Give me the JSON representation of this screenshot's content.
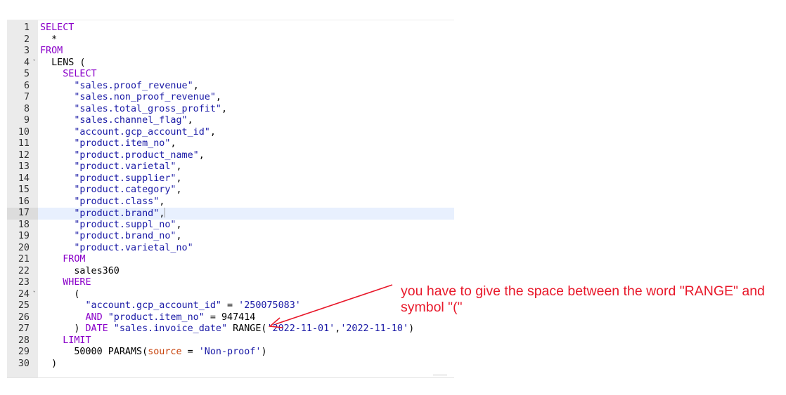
{
  "editor": {
    "active_line": 17,
    "fold_lines": [
      4,
      24
    ],
    "lines": [
      {
        "n": "1",
        "tokens": [
          {
            "t": "SELECT",
            "c": "kw"
          }
        ]
      },
      {
        "n": "2",
        "tokens": [
          {
            "t": "  *",
            "c": ""
          }
        ]
      },
      {
        "n": "3",
        "tokens": [
          {
            "t": "FROM",
            "c": "kw"
          }
        ]
      },
      {
        "n": "4",
        "tokens": [
          {
            "t": "  LENS (",
            "c": ""
          }
        ]
      },
      {
        "n": "5",
        "tokens": [
          {
            "t": "    ",
            "c": ""
          },
          {
            "t": "SELECT",
            "c": "kw"
          }
        ]
      },
      {
        "n": "6",
        "tokens": [
          {
            "t": "      ",
            "c": ""
          },
          {
            "t": "\"sales.proof_revenue\"",
            "c": "str"
          },
          {
            "t": ",",
            "c": ""
          }
        ]
      },
      {
        "n": "7",
        "tokens": [
          {
            "t": "      ",
            "c": ""
          },
          {
            "t": "\"sales.non_proof_revenue\"",
            "c": "str"
          },
          {
            "t": ",",
            "c": ""
          }
        ]
      },
      {
        "n": "8",
        "tokens": [
          {
            "t": "      ",
            "c": ""
          },
          {
            "t": "\"sales.total_gross_profit\"",
            "c": "str"
          },
          {
            "t": ",",
            "c": ""
          }
        ]
      },
      {
        "n": "9",
        "tokens": [
          {
            "t": "      ",
            "c": ""
          },
          {
            "t": "\"sales.channel_flag\"",
            "c": "str"
          },
          {
            "t": ",",
            "c": ""
          }
        ]
      },
      {
        "n": "10",
        "tokens": [
          {
            "t": "      ",
            "c": ""
          },
          {
            "t": "\"account.gcp_account_id\"",
            "c": "str"
          },
          {
            "t": ",",
            "c": ""
          }
        ]
      },
      {
        "n": "11",
        "tokens": [
          {
            "t": "      ",
            "c": ""
          },
          {
            "t": "\"product.item_no\"",
            "c": "str"
          },
          {
            "t": ",",
            "c": ""
          }
        ]
      },
      {
        "n": "12",
        "tokens": [
          {
            "t": "      ",
            "c": ""
          },
          {
            "t": "\"product.product_name\"",
            "c": "str"
          },
          {
            "t": ",",
            "c": ""
          }
        ]
      },
      {
        "n": "13",
        "tokens": [
          {
            "t": "      ",
            "c": ""
          },
          {
            "t": "\"product.varietal\"",
            "c": "str"
          },
          {
            "t": ",",
            "c": ""
          }
        ]
      },
      {
        "n": "14",
        "tokens": [
          {
            "t": "      ",
            "c": ""
          },
          {
            "t": "\"product.supplier\"",
            "c": "str"
          },
          {
            "t": ",",
            "c": ""
          }
        ]
      },
      {
        "n": "15",
        "tokens": [
          {
            "t": "      ",
            "c": ""
          },
          {
            "t": "\"product.category\"",
            "c": "str"
          },
          {
            "t": ",",
            "c": ""
          }
        ]
      },
      {
        "n": "16",
        "tokens": [
          {
            "t": "      ",
            "c": ""
          },
          {
            "t": "\"product.class\"",
            "c": "str"
          },
          {
            "t": ",",
            "c": ""
          }
        ]
      },
      {
        "n": "17",
        "tokens": [
          {
            "t": "      ",
            "c": ""
          },
          {
            "t": "\"product.brand\"",
            "c": "str"
          },
          {
            "t": ",",
            "c": ""
          }
        ]
      },
      {
        "n": "18",
        "tokens": [
          {
            "t": "      ",
            "c": ""
          },
          {
            "t": "\"product.suppl_no\"",
            "c": "str"
          },
          {
            "t": ",",
            "c": ""
          }
        ]
      },
      {
        "n": "19",
        "tokens": [
          {
            "t": "      ",
            "c": ""
          },
          {
            "t": "\"product.brand_no\"",
            "c": "str"
          },
          {
            "t": ",",
            "c": ""
          }
        ]
      },
      {
        "n": "20",
        "tokens": [
          {
            "t": "      ",
            "c": ""
          },
          {
            "t": "\"product.varietal_no\"",
            "c": "str"
          }
        ]
      },
      {
        "n": "21",
        "tokens": [
          {
            "t": "    ",
            "c": ""
          },
          {
            "t": "FROM",
            "c": "kw"
          }
        ]
      },
      {
        "n": "22",
        "tokens": [
          {
            "t": "      sales360",
            "c": ""
          }
        ]
      },
      {
        "n": "23",
        "tokens": [
          {
            "t": "    ",
            "c": ""
          },
          {
            "t": "WHERE",
            "c": "kw"
          }
        ]
      },
      {
        "n": "24",
        "tokens": [
          {
            "t": "      (",
            "c": ""
          }
        ]
      },
      {
        "n": "25",
        "tokens": [
          {
            "t": "        ",
            "c": ""
          },
          {
            "t": "\"account.gcp_account_id\"",
            "c": "str"
          },
          {
            "t": " = ",
            "c": ""
          },
          {
            "t": "'250075083'",
            "c": "str"
          }
        ]
      },
      {
        "n": "26",
        "tokens": [
          {
            "t": "        ",
            "c": ""
          },
          {
            "t": "AND",
            "c": "kw"
          },
          {
            "t": " ",
            "c": ""
          },
          {
            "t": "\"product.item_no\"",
            "c": "str"
          },
          {
            "t": " = ",
            "c": ""
          },
          {
            "t": "947414",
            "c": "num"
          }
        ]
      },
      {
        "n": "27",
        "tokens": [
          {
            "t": "      ) ",
            "c": ""
          },
          {
            "t": "DATE",
            "c": "kw"
          },
          {
            "t": " ",
            "c": ""
          },
          {
            "t": "\"sales.invoice_date\"",
            "c": "str"
          },
          {
            "t": " RANGE(",
            "c": "fn"
          },
          {
            "t": "'2022-11-01'",
            "c": "str"
          },
          {
            "t": ",",
            "c": ""
          },
          {
            "t": "'2022-11-10'",
            "c": "str"
          },
          {
            "t": ")",
            "c": ""
          }
        ]
      },
      {
        "n": "28",
        "tokens": [
          {
            "t": "    ",
            "c": ""
          },
          {
            "t": "LIMIT",
            "c": "kw"
          }
        ]
      },
      {
        "n": "29",
        "tokens": [
          {
            "t": "      50000 PARAMS(",
            "c": ""
          },
          {
            "t": "source",
            "c": "par"
          },
          {
            "t": " = ",
            "c": ""
          },
          {
            "t": "'Non-proof'",
            "c": "str"
          },
          {
            "t": ")",
            "c": ""
          }
        ]
      },
      {
        "n": "30",
        "tokens": [
          {
            "t": "  )",
            "c": ""
          }
        ]
      }
    ]
  },
  "annotation": {
    "line1": "you have to give the space between the word \"RANGE\" and",
    "line2": "symbol \"(\"",
    "color": "#e8182a"
  }
}
